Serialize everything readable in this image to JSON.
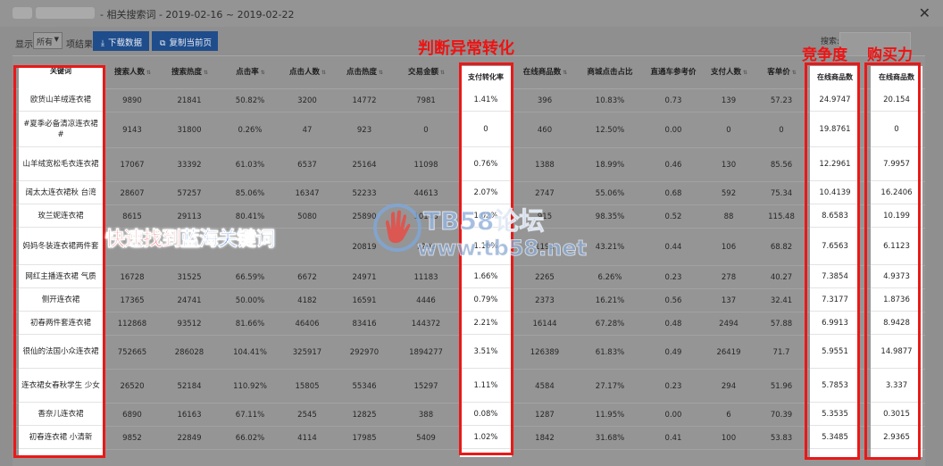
{
  "title_bar": {
    "title": "- 相关搜索词 - 2019-02-16 ~ 2019-02-22",
    "close_icon": "close-icon"
  },
  "toolbar": {
    "show_label": "显示",
    "page_size_value": "所有",
    "items_label": "项结果",
    "download_label": "下载数据",
    "download_icon": "download-icon",
    "copy_label": "复制当前页",
    "copy_icon": "copy-icon",
    "search_fragment": "搜索:"
  },
  "table": {
    "headers": [
      "关键词",
      "搜索人数",
      "搜索热度",
      "点击率",
      "点击人数",
      "点击热度",
      "交易金额",
      "支付转化率",
      "在线商品数",
      "商城点击占比",
      "直通车参考价",
      "支付人数",
      "客单价",
      "在线商品数",
      "在线商品数"
    ],
    "rows": [
      [
        "欧货山羊绒连衣裙",
        "9890",
        "21841",
        "50.82%",
        "3200",
        "14772",
        "7981",
        "1.41%",
        "396",
        "10.83%",
        "0.73",
        "139",
        "57.23",
        "24.9747",
        "20.154"
      ],
      [
        "#夏季必备清凉连衣裙#",
        "9143",
        "31800",
        "0.26%",
        "47",
        "923",
        "0",
        "0",
        "460",
        "12.50%",
        "0.00",
        "0",
        "0",
        "19.8761",
        "0"
      ],
      [
        "山羊绒宽松毛衣连衣裙",
        "17067",
        "33392",
        "61.03%",
        "6537",
        "25164",
        "11098",
        "0.76%",
        "1388",
        "18.99%",
        "0.46",
        "130",
        "85.56",
        "12.2961",
        "7.9957"
      ],
      [
        "阔太太连衣裙秋 台湾",
        "28607",
        "57257",
        "85.06%",
        "16347",
        "52233",
        "44613",
        "2.07%",
        "2747",
        "55.06%",
        "0.68",
        "592",
        "75.34",
        "10.4139",
        "16.2406"
      ],
      [
        "玫兰妮连衣裙",
        "8615",
        "29113",
        "80.41%",
        "5080",
        "25890",
        "10148",
        "1.02%",
        "915",
        "98.35%",
        "0.52",
        "88",
        "115.48",
        "8.6583",
        "10.199"
      ],
      [
        "妈妈冬装连衣裙两件套",
        "",
        "",
        "",
        "",
        "20819",
        "7292",
        "1.16%",
        "1193",
        "43.21%",
        "0.44",
        "106",
        "68.82",
        "7.6563",
        "6.1123"
      ],
      [
        "网红主播连衣裙 气质",
        "16728",
        "31525",
        "66.59%",
        "6672",
        "24971",
        "11183",
        "1.66%",
        "2265",
        "6.26%",
        "0.23",
        "278",
        "40.27",
        "7.3854",
        "4.9373"
      ],
      [
        "侧开连衣裙",
        "17365",
        "24741",
        "50.00%",
        "4182",
        "16591",
        "4446",
        "0.79%",
        "2373",
        "16.21%",
        "0.56",
        "137",
        "32.41",
        "7.3177",
        "1.8736"
      ],
      [
        "初春两件套连衣裙",
        "112868",
        "93512",
        "81.66%",
        "46406",
        "83416",
        "144372",
        "2.21%",
        "16144",
        "67.28%",
        "0.48",
        "2494",
        "57.88",
        "6.9913",
        "8.9428"
      ],
      [
        "很仙的法国小众连衣裙",
        "752665",
        "286028",
        "104.41%",
        "325917",
        "292970",
        "1894277",
        "3.51%",
        "126389",
        "61.83%",
        "0.49",
        "26419",
        "71.7",
        "5.9551",
        "14.9877"
      ],
      [
        "连衣裙女春秋学生 少女",
        "26520",
        "52184",
        "110.92%",
        "15805",
        "55346",
        "15297",
        "1.11%",
        "4584",
        "27.17%",
        "0.23",
        "294",
        "51.96",
        "5.7853",
        "3.337"
      ],
      [
        "香奈儿连衣裙",
        "6890",
        "16163",
        "67.11%",
        "2545",
        "12825",
        "388",
        "0.08%",
        "1287",
        "11.95%",
        "0.00",
        "6",
        "70.39",
        "5.3535",
        "0.3015"
      ],
      [
        "初春连衣裙 小清新",
        "9852",
        "22849",
        "66.02%",
        "4114",
        "17985",
        "5409",
        "1.02%",
        "1842",
        "31.68%",
        "0.41",
        "100",
        "53.83",
        "5.3485",
        "2.9365"
      ]
    ]
  },
  "annotations": {
    "conversion_label": "判断异常转化",
    "competition_label": "竞争度",
    "buying_power_label": "购买力",
    "slogan_red_1": "快速找到",
    "slogan_blue": "蓝海关键词",
    "highlight_color": "#ea1818",
    "slogan_blue_color": "#1d5fd6"
  },
  "watermark": {
    "brand": "TB58论坛",
    "url": "www.tb58.net"
  }
}
